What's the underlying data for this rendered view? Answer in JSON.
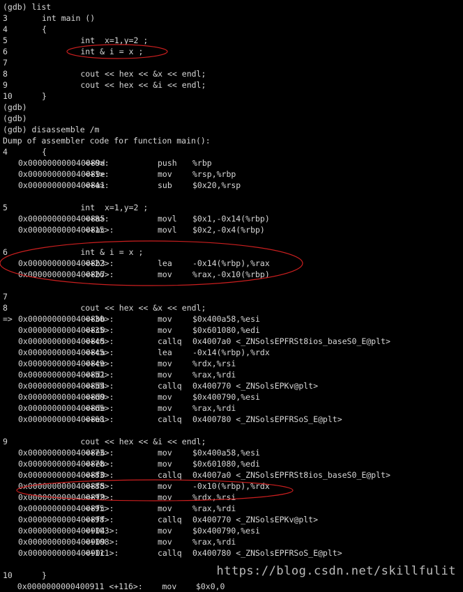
{
  "colors": {
    "background": "#000000",
    "text": "#d8d8d8",
    "annotation": "#cc1f1f",
    "watermark": "#bbbbbb"
  },
  "watermark": "https://blog.csdn.net/skillfulit",
  "lines": [
    {
      "text": "(gdb) list"
    },
    {
      "src": [
        "3",
        "int main ()"
      ]
    },
    {
      "src": [
        "4",
        "{"
      ]
    },
    {
      "src": [
        "5",
        "        int  x=1,y=2 ;"
      ]
    },
    {
      "src": [
        "6",
        "        int & i = x ;"
      ]
    },
    {
      "src": [
        "7",
        ""
      ]
    },
    {
      "src": [
        "8",
        "        cout << hex << &x << endl;"
      ]
    },
    {
      "src": [
        "9",
        "        cout << hex << &i << endl;"
      ]
    },
    {
      "src": [
        "10",
        "}"
      ]
    },
    {
      "text": "(gdb)"
    },
    {
      "text": "(gdb)"
    },
    {
      "text": "(gdb) disassemble /m"
    },
    {
      "text": "Dump of assembler code for function main():"
    },
    {
      "src": [
        "4",
        "{"
      ]
    },
    {
      "asm": [
        "",
        "0x000000000040089d",
        "<+0>:",
        "push",
        "%rbp"
      ]
    },
    {
      "asm": [
        "",
        "0x000000000040089e",
        "<+1>:",
        "mov",
        "%rsp,%rbp"
      ]
    },
    {
      "asm": [
        "",
        "0x00000000004008a1",
        "<+4>:",
        "sub",
        "$0x20,%rsp"
      ]
    },
    {
      "text": ""
    },
    {
      "src": [
        "5",
        "        int  x=1,y=2 ;"
      ]
    },
    {
      "asm": [
        "",
        "0x00000000004008a5",
        "<+8>:",
        "movl",
        "$0x1,-0x14(%rbp)"
      ]
    },
    {
      "asm": [
        "",
        "0x00000000004008ac",
        "<+15>:",
        "movl",
        "$0x2,-0x4(%rbp)"
      ]
    },
    {
      "text": ""
    },
    {
      "src": [
        "6",
        "        int & i = x ;"
      ]
    },
    {
      "asm": [
        "",
        "0x00000000004008b3",
        "<+22>:",
        "lea",
        "-0x14(%rbp),%rax"
      ]
    },
    {
      "asm": [
        "",
        "0x00000000004008b7",
        "<+26>:",
        "mov",
        "%rax,-0x10(%rbp)"
      ]
    },
    {
      "text": ""
    },
    {
      "src": [
        "7",
        ""
      ]
    },
    {
      "src": [
        "8",
        "        cout << hex << &x << endl;"
      ]
    },
    {
      "asm": [
        "=>",
        "0x00000000004008bb",
        "<+30>:",
        "mov",
        "$0x400a58,%esi"
      ]
    },
    {
      "asm": [
        "",
        "0x00000000004008c0",
        "<+35>:",
        "mov",
        "$0x601080,%edi"
      ]
    },
    {
      "asm": [
        "",
        "0x00000000004008c5",
        "<+40>:",
        "callq",
        "0x4007a0 <_ZNSolsEPFRSt8ios_baseS0_E@plt>"
      ]
    },
    {
      "asm": [
        "",
        "0x00000000004008ca",
        "<+45>:",
        "lea",
        "-0x14(%rbp),%rdx"
      ]
    },
    {
      "asm": [
        "",
        "0x00000000004008ce",
        "<+49>:",
        "mov",
        "%rdx,%rsi"
      ]
    },
    {
      "asm": [
        "",
        "0x00000000004008d1",
        "<+52>:",
        "mov",
        "%rax,%rdi"
      ]
    },
    {
      "asm": [
        "",
        "0x00000000004008d4",
        "<+55>:",
        "callq",
        "0x400770 <_ZNSolsEPKv@plt>"
      ]
    },
    {
      "asm": [
        "",
        "0x00000000004008d9",
        "<+60>:",
        "mov",
        "$0x400790,%esi"
      ]
    },
    {
      "asm": [
        "",
        "0x00000000004008de",
        "<+65>:",
        "mov",
        "%rax,%rdi"
      ]
    },
    {
      "asm": [
        "",
        "0x00000000004008e1",
        "<+68>:",
        "callq",
        "0x400780 <_ZNSolsEPFRSoS_E@plt>"
      ]
    },
    {
      "text": ""
    },
    {
      "src": [
        "9",
        "        cout << hex << &i << endl;"
      ]
    },
    {
      "asm": [
        "",
        "0x00000000004008e6",
        "<+73>:",
        "mov",
        "$0x400a58,%esi"
      ]
    },
    {
      "asm": [
        "",
        "0x00000000004008eb",
        "<+78>:",
        "mov",
        "$0x601080,%edi"
      ]
    },
    {
      "asm": [
        "",
        "0x00000000004008f0",
        "<+83>:",
        "callq",
        "0x4007a0 <_ZNSolsEPFRSt8ios_baseS0_E@plt>"
      ]
    },
    {
      "asm": [
        "",
        "0x00000000004008f5",
        "<+88>:",
        "mov",
        "-0x10(%rbp),%rdx"
      ]
    },
    {
      "asm": [
        "",
        "0x00000000004008f9",
        "<+92>:",
        "mov",
        "%rdx,%rsi"
      ]
    },
    {
      "asm": [
        "",
        "0x00000000004008fc",
        "<+95>:",
        "mov",
        "%rax,%rdi"
      ]
    },
    {
      "asm": [
        "",
        "0x00000000004008ff",
        "<+98>:",
        "callq",
        "0x400770 <_ZNSolsEPKv@plt>"
      ]
    },
    {
      "asm": [
        "",
        "0x0000000000400904",
        "<+103>:",
        "mov",
        "$0x400790,%esi"
      ]
    },
    {
      "asm": [
        "",
        "0x0000000000400909",
        "<+108>:",
        "mov",
        "%rax,%rdi"
      ]
    },
    {
      "asm": [
        "",
        "0x000000000040090c",
        "<+111>:",
        "callq",
        "0x400780 <_ZNSolsEPFRSoS_E@plt>"
      ]
    },
    {
      "text": ""
    },
    {
      "src": [
        "10",
        "}"
      ]
    },
    {
      "text": "   0x0000000000400911 <+116>:    mov    $0x0,0"
    }
  ]
}
